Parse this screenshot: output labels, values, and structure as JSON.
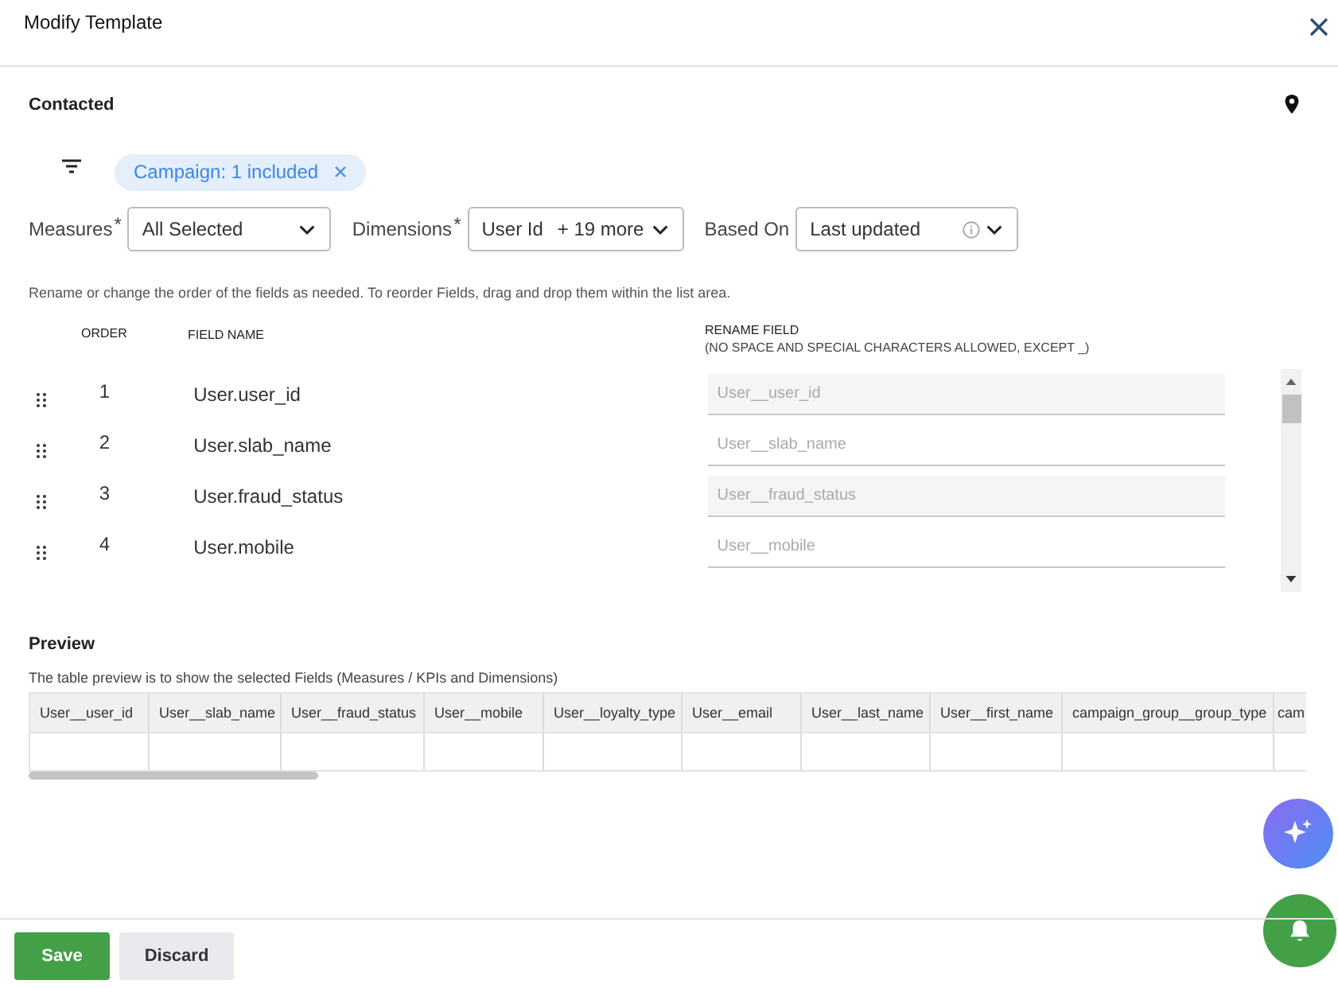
{
  "window": {
    "title": "Modify Template"
  },
  "section": {
    "title": "Contacted"
  },
  "filter_chip": {
    "label": "Campaign: 1 included"
  },
  "controls": [
    {
      "label": "Measures",
      "marker": "*",
      "value": "All Selected",
      "info": false
    },
    {
      "label": "Dimensions",
      "marker": "*",
      "value": "User Id",
      "extra": "+ 19 more",
      "info": false
    },
    {
      "label": "Based On",
      "value": "Last updated",
      "info": true
    }
  ],
  "hint": "Rename or change the order of the fields as needed. To reorder Fields, drag and drop them within the list area.",
  "fields_table": {
    "columns": [
      "ORDER",
      "FIELD NAME"
    ],
    "rename_column": "RENAME FIELD",
    "rename_note": "(NO SPACE AND SPECIAL CHARACTERS ALLOWED, EXCEPT _)",
    "rows": [
      {
        "order": "1",
        "field": "User.user_id",
        "placeholder": "User__user_id"
      },
      {
        "order": "2",
        "field": "User.slab_name",
        "placeholder": "User__slab_name"
      },
      {
        "order": "3",
        "field": "User.fraud_status",
        "placeholder": "User__fraud_status"
      },
      {
        "order": "4",
        "field": "User.mobile",
        "placeholder": "User__mobile"
      }
    ]
  },
  "preview": {
    "title": "Preview",
    "note": "The table preview is to show the selected Fields (Measures / KPIs and Dimensions)",
    "columns": [
      "User__user_id",
      "User__slab_name",
      "User__fraud_status",
      "User__mobile",
      "User__loyalty_type",
      "User__email",
      "User__last_name",
      "User__first_name",
      "campaign_group__group_type",
      "cam"
    ]
  },
  "buttons": [
    {
      "label": "Save",
      "kind": "primary"
    },
    {
      "label": "Discard",
      "kind": "secondary"
    }
  ]
}
